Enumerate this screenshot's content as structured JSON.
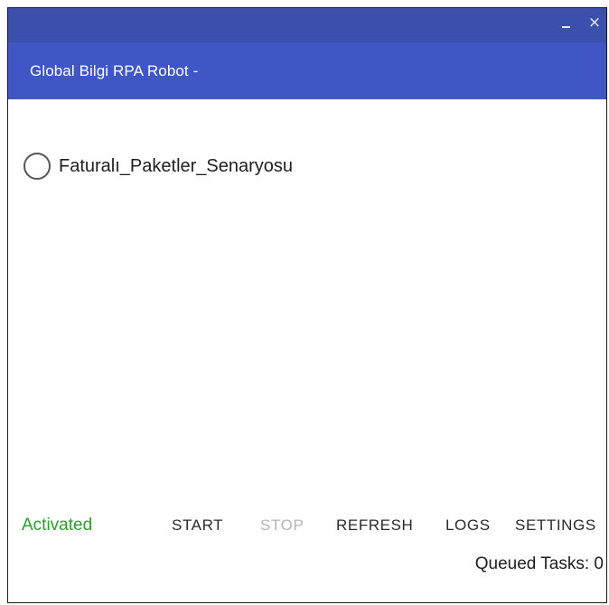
{
  "window": {
    "app_title": "Global Bilgi RPA Robot -",
    "controls": {
      "minimize": "_",
      "close": "×"
    }
  },
  "scenarios": [
    {
      "label": "Faturalı_Paketler_Senaryosu",
      "selected": false
    }
  ],
  "footer": {
    "status": "Activated",
    "buttons": {
      "start": "START",
      "stop": "STOP",
      "refresh": "REFRESH",
      "logs": "LOGS",
      "settings": "SETTINGS"
    },
    "queued_tasks": "Queued Tasks: 0"
  },
  "colors": {
    "titlebar": "#3b4fad",
    "appbar": "#3f56c4",
    "status_active": "#2e9b2e",
    "disabled_button": "#b3b3b3"
  }
}
